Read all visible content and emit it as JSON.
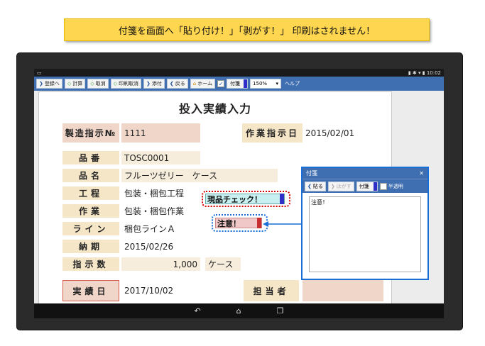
{
  "banner": {
    "text": "付箋を画面へ「貼り付け！」「剥がす！」 印刷はされません！"
  },
  "status": {
    "time": "10:02"
  },
  "toolbar": {
    "register": "登録へ",
    "calc": "計算",
    "cancel": "取消",
    "print_cancel": "印刷取消",
    "attach": "添付",
    "back": "戻る",
    "home": "ホーム",
    "fusen": "付箋",
    "zoom": "150%",
    "help": "ヘルプ"
  },
  "form": {
    "title": "投入実績入力",
    "labels": {
      "mfg_no": "製造指示№",
      "work_date": "作業指示日",
      "item_no": "品番",
      "item_name": "品名",
      "process": "工程",
      "work": "作業",
      "line": "ライン",
      "due": "納期",
      "qty": "指示数",
      "actual_date": "実績日",
      "person": "担当者"
    },
    "values": {
      "mfg_no": "1111",
      "work_date": "2015/02/01",
      "item_no": "TOSC0001",
      "item_name": "フルーツゼリー　ケース",
      "process": "包装・梱包工程",
      "work": "包装・梱包作業",
      "line": "梱包ラインＡ",
      "due": "2015/02/26",
      "qty": "1,000",
      "unit": "ケース",
      "actual_date": "2017/10/02"
    }
  },
  "notes": {
    "note1": "現品チェック！",
    "note2": "注意！"
  },
  "panel": {
    "title": "付箋",
    "paste": "貼る",
    "peel": "はがす",
    "fusen": "付箋",
    "semi": "半透明",
    "content": "注意！"
  }
}
